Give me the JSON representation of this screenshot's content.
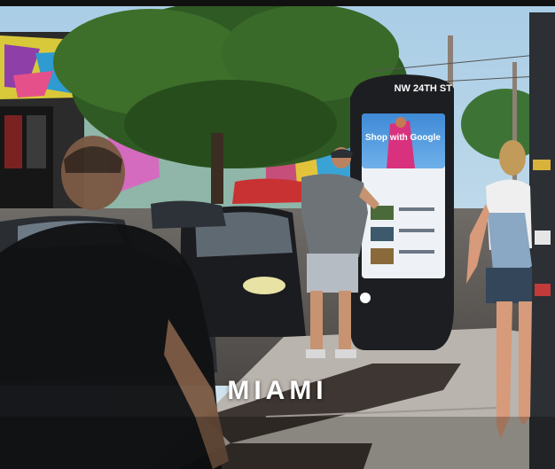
{
  "photo": {
    "city_label": "MIAMI",
    "kiosk": {
      "street_sign": "NW 24TH ST",
      "screen_headline": "Shop with Google"
    }
  }
}
